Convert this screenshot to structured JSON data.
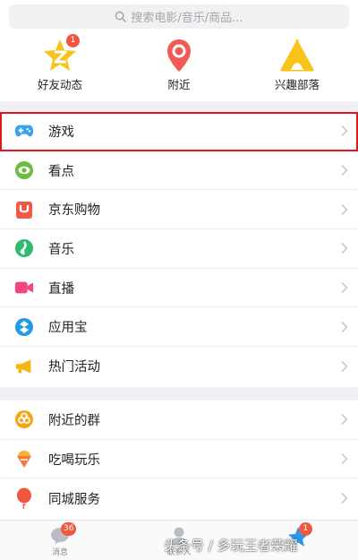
{
  "search": {
    "placeholder": "搜索电影/音乐/商品..."
  },
  "quick_links": [
    {
      "label": "好友动态",
      "badge": "1",
      "icon": "qzone-star-icon"
    },
    {
      "label": "附近",
      "icon": "location-pin-icon"
    },
    {
      "label": "兴趣部落",
      "icon": "tribe-tent-icon"
    }
  ],
  "menu_group1": [
    {
      "label": "游戏",
      "icon": "gamepad-icon",
      "highlighted": true
    },
    {
      "label": "看点",
      "icon": "eye-icon"
    },
    {
      "label": "京东购物",
      "icon": "jd-shopping-icon"
    },
    {
      "label": "音乐",
      "icon": "music-icon"
    },
    {
      "label": "直播",
      "icon": "video-camera-icon"
    },
    {
      "label": "应用宝",
      "icon": "app-store-icon"
    },
    {
      "label": "热门活动",
      "icon": "megaphone-icon"
    }
  ],
  "menu_group2": [
    {
      "label": "附近的群",
      "icon": "nearby-group-icon"
    },
    {
      "label": "吃喝玩乐",
      "icon": "ice-cream-icon"
    },
    {
      "label": "同城服务",
      "icon": "balloon-icon"
    }
  ],
  "tabbar": {
    "messages": {
      "label": "消息",
      "badge": "36"
    },
    "contacts": {
      "label": "联系人"
    },
    "dynamic": {
      "badge": "1"
    }
  },
  "watermark": "头条号 / 多玩王者荣耀",
  "colors": {
    "highlight": "#e0161d",
    "badge": "#f0573f",
    "group_bg": "#efeff4"
  }
}
